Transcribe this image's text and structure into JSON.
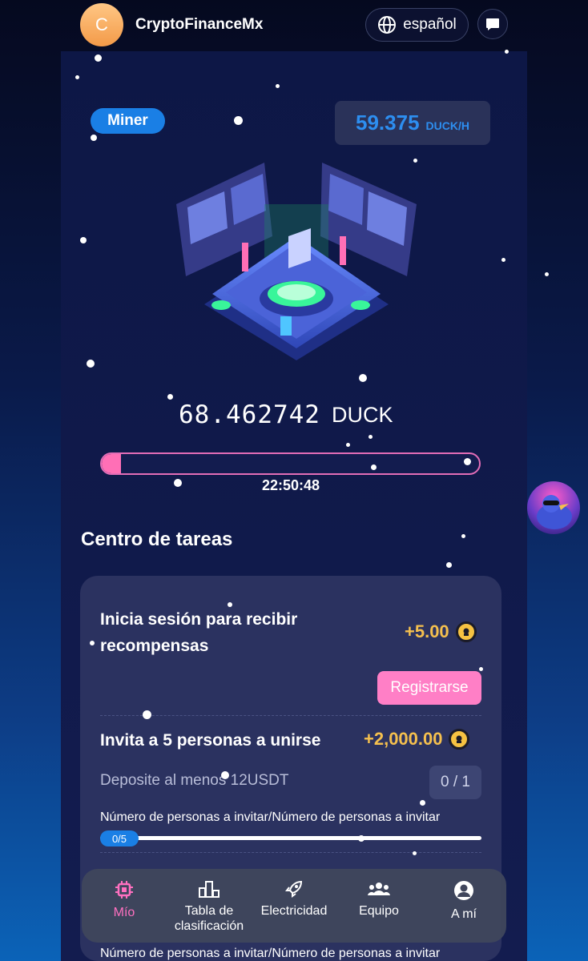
{
  "header": {
    "avatar_initial": "C",
    "brand": "CryptoFinanceMx",
    "language": "español"
  },
  "miner": {
    "badge": "Miner",
    "rate_value": "59.375",
    "rate_unit": "DUCK/H",
    "balance_value": "68.462742",
    "balance_unit": "DUCK",
    "progress_fraction": 0.05,
    "timer": "22:50:48"
  },
  "tasks": {
    "section_title": "Centro de tareas",
    "items": [
      {
        "title": "Inicia sesión para recibir recompensas",
        "reward": "+5.00",
        "button": "Registrarse"
      },
      {
        "title": "Invita a 5 personas a unirse",
        "reward": "+2,000.00",
        "requirement": "Deposite al menos 12USDT",
        "count": "0 / 1",
        "progress_label": "Número de personas a invitar/Número de personas a invitar",
        "progress_pill": "0/5"
      }
    ],
    "next_label": "Número de personas a invitar/Número de personas a invitar"
  },
  "nav": [
    {
      "label": "Mío",
      "icon": "chip-icon",
      "active": true
    },
    {
      "label": "Tabla de clasificación",
      "icon": "ranking-icon",
      "active": false
    },
    {
      "label": "Electricidad",
      "icon": "rocket-icon",
      "active": false
    },
    {
      "label": "Equipo",
      "icon": "team-icon",
      "active": false
    },
    {
      "label": "A mí",
      "icon": "user-icon",
      "active": false
    }
  ],
  "colors": {
    "accent_pink": "#ff7fc6",
    "accent_blue": "#1a7fe5",
    "reward_gold": "#f5c04e"
  }
}
